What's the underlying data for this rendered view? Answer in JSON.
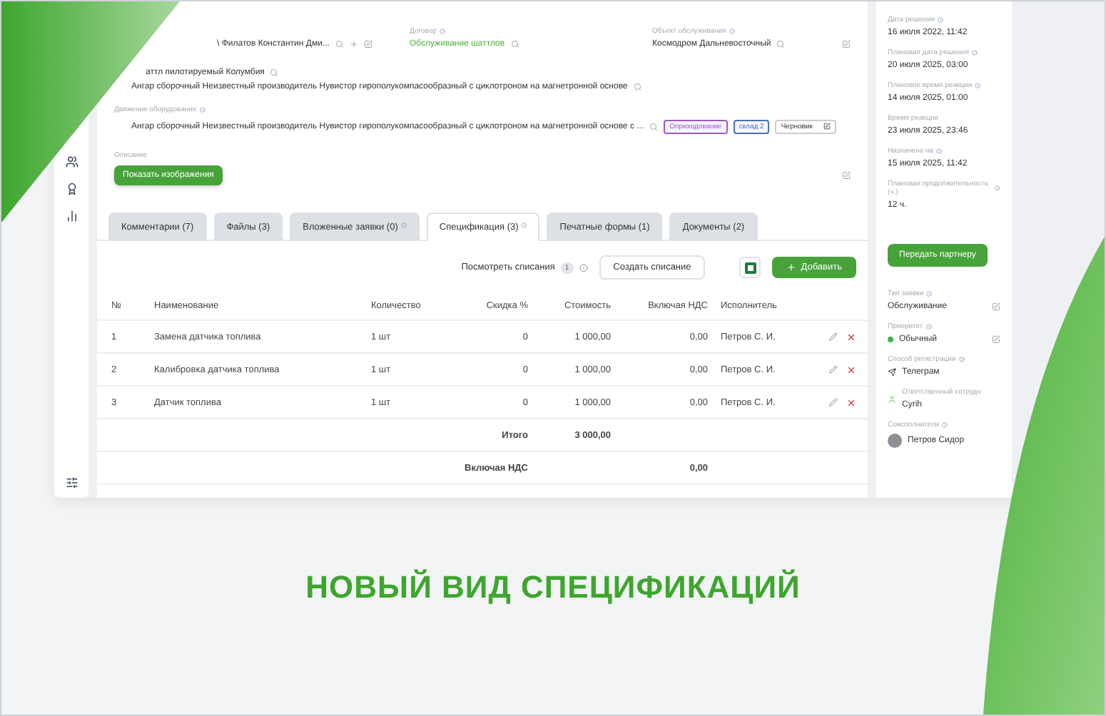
{
  "request": {
    "client": "\\ Филатов Константин Дми...",
    "contract": {
      "label": "Договор",
      "value": "Обслуживание шаттлов"
    },
    "object": {
      "label": "Объект обслуживания",
      "value": "Космодром Дальневосточный"
    },
    "equipment": {
      "name": "аттл пилотируемый Колумбия",
      "location": "Ангар сборочный Неизвестный производитель Нувистор гирополукомпасообразный с циклотроном на магнетронной основе"
    },
    "movement": {
      "label": "Движение оборудования",
      "value": "Ангар сборочный Неизвестный производитель Нувистор гирополукомпасообразный с циклотроном на магнетронной основе с ...",
      "tags": [
        {
          "text": "Оприходование",
          "color": "#9b59c9"
        },
        {
          "text": "склад 2",
          "color": "#4a6fb5"
        }
      ],
      "status": "Черновик"
    },
    "description": {
      "label": "Описание",
      "button": "Показать изображения"
    }
  },
  "tabs": [
    {
      "label": "Комментарии (7)",
      "selected": false,
      "info": false
    },
    {
      "label": "Файлы (3)",
      "selected": false,
      "info": false
    },
    {
      "label": "Вложенные заявки (0)",
      "selected": false,
      "info": true
    },
    {
      "label": "Спецификация (3)",
      "selected": true,
      "info": true
    },
    {
      "label": "Печатные формы (1)",
      "selected": false,
      "info": false
    },
    {
      "label": "Документы (2)",
      "selected": false,
      "info": false
    }
  ],
  "toolbar": {
    "writeoffs_link": "Посмотреть списания",
    "writeoffs_count": "1",
    "create_button": "Создать списание",
    "add_button": "Добавить"
  },
  "table": {
    "columns": [
      "№",
      "Наименование",
      "Количество",
      "Скидка %",
      "Стоимость",
      "Включая НДС",
      "Исполнитель"
    ],
    "rows": [
      [
        "1",
        "Замена датчика топлива",
        "1 шт",
        "0",
        "1 000,00",
        "0,00",
        "Петров С. И."
      ],
      [
        "2",
        "Калибровка датчика топлива",
        "1 шт",
        "0",
        "1 000,00",
        "0,00",
        "Петров С. И."
      ],
      [
        "3",
        "Датчик топлива",
        "1 шт",
        "0",
        "1 000,00",
        "0,00",
        "Петров С. И."
      ]
    ],
    "total": {
      "label": "Итого",
      "value": "3 000,00"
    },
    "vat": {
      "label": "Включая НДС",
      "value": "0,00"
    }
  },
  "side_panel": {
    "dates": [
      {
        "label": "Дата решения",
        "value": "16 июля 2022, 11:42",
        "info": true
      },
      {
        "label": "Плановая дата решения",
        "value": "20 июля 2025, 03:00",
        "info": true
      },
      {
        "label": "Плановое время реакции",
        "value": "14 июля 2025, 01:00",
        "info": true
      },
      {
        "label": "Время реакции",
        "value": "23 июля 2025, 23:46",
        "info": false
      },
      {
        "label": "Назначена на",
        "value": "15 июля 2025, 11:42",
        "info": true
      },
      {
        "label": "Плановая продолжительность (ч.)",
        "value": "12 ч.",
        "info": true
      }
    ],
    "transfer_button": "Передать партнеру",
    "details": [
      {
        "kind": "text",
        "label": "Тип заявки",
        "value": "Обслуживание"
      },
      {
        "kind": "dot",
        "label": "Приоритет",
        "value": "Обычный",
        "color": "#3fb44a"
      },
      {
        "kind": "channel",
        "label": "Способ регистрации",
        "value": "Телеграм"
      },
      {
        "kind": "responsible",
        "label": "Ответственный сотрудн",
        "value": "Cyrih"
      },
      {
        "kind": "person",
        "label": "Соисполнители",
        "value": "Петров Сидор"
      }
    ]
  },
  "headline": "НОВЫЙ ВИД СПЕЦИФИКАЦИЙ"
}
